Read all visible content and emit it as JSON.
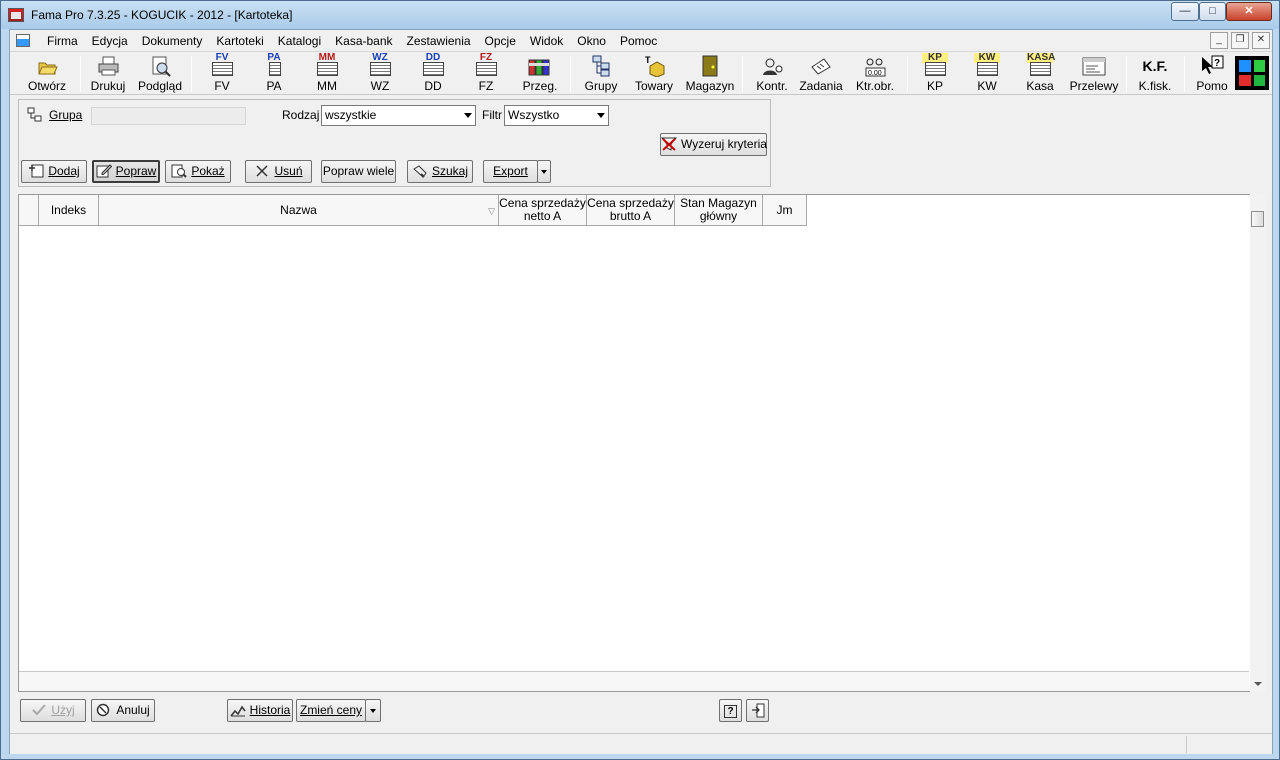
{
  "window": {
    "title": "Fama Pro 7.3.25 - KOGUCIK - 2012 - [Kartoteka]",
    "min_label": "—",
    "max_label": "□",
    "close_label": "✕"
  },
  "menu": {
    "items": [
      "Firma",
      "Edycja",
      "Dokumenty",
      "Kartoteki",
      "Katalogi",
      "Kasa-bank",
      "Zestawienia",
      "Opcje",
      "Widok",
      "Okno",
      "Pomoc"
    ],
    "mdi_buttons": [
      "_",
      "❐",
      "✕"
    ]
  },
  "toolbar": {
    "otworz": "Otwórz",
    "drukuj": "Drukuj",
    "podglad": "Podgląd",
    "fv": "FV",
    "fv_code": "FV",
    "pa": "PA",
    "pa_code": "PA",
    "mm": "MM",
    "mm_code": "MM",
    "wz": "WZ",
    "wz_code": "WZ",
    "dd": "DD",
    "dd_code": "DD",
    "fz": "FZ",
    "fz_code": "FZ",
    "przeg": "Przeg.",
    "grupy": "Grupy",
    "towary": "Towary",
    "magazyn": "Magazyn",
    "kontr": "Kontr.",
    "zadania": "Zadania",
    "ktrobr": "Ktr.obr.",
    "ktrobr_code": "0.00",
    "kp": "KP",
    "kp_code": "KP",
    "kw": "KW",
    "kw_code": "KW",
    "kasa": "Kasa",
    "kasa_code": "KASA",
    "przelewy": "Przelewy",
    "kfisk": "K.fisk.",
    "kfisk_code": "K.F.",
    "pomo": "Pomo",
    "palette_colors": [
      "#1e90ff",
      "#2ecc40",
      "#e32d2d",
      "#1fb53f"
    ]
  },
  "filters": {
    "grupa_label": "Grupa",
    "rodzaj_label": "Rodzaj",
    "rodzaj_value": "wszystkie",
    "filtr_label": "Filtr",
    "filtr_value": "Wszystko",
    "wyzeruj_label": "Wyzeruj kryteria"
  },
  "actions": {
    "dodaj": "Dodaj",
    "popraw": "Popraw",
    "pokaz": "Pokaż",
    "usun": "Usuń",
    "popraw_wiele": "Popraw wiele",
    "szukaj": "Szukaj",
    "export": "Export"
  },
  "table": {
    "columns": [
      "",
      "Indeks",
      "Nazwa",
      "Cena sprzedaży netto A",
      "Cena sprzedaży brutto A",
      "Stan Magazyn główny",
      "Jm"
    ],
    "rows": []
  },
  "bottom": {
    "uzyj": "Użyj",
    "anuluj": "Anuluj",
    "historia": "Historia",
    "zmien_ceny": "Zmień ceny"
  }
}
